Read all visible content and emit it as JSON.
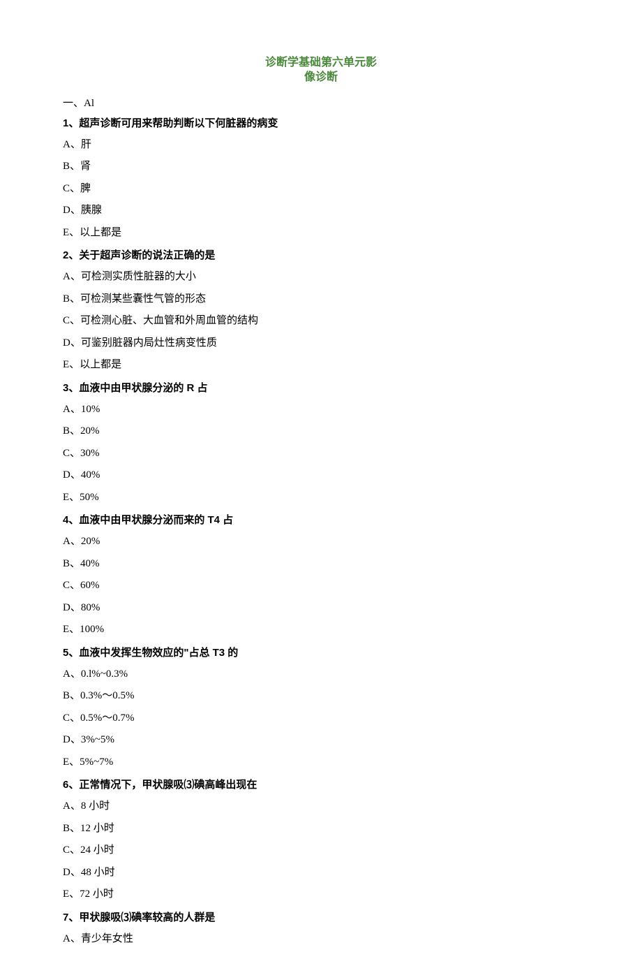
{
  "title_line1": "诊断学基础第六单元影",
  "title_line2": "像诊断",
  "section_label": "一、Al",
  "questions": [
    {
      "stem": "1、超声诊断可用来帮助判断以下何脏器的病变",
      "options": [
        "A、肝",
        "B、肾",
        "C、脾",
        "D、胰腺",
        "E、以上都是"
      ]
    },
    {
      "stem": "2、关于超声诊断的说法正确的是",
      "options": [
        "A、可检测实质性脏器的大小",
        "B、可检测某些囊性气管的形态",
        "C、可检测心脏、大血管和外周血管的结构",
        "D、可鉴别脏器内局灶性病变性质",
        "E、以上都是"
      ]
    },
    {
      "stem": "3、血液中由甲状腺分泌的 R 占",
      "options": [
        "A、10%",
        "B、20%",
        "C、30%",
        "D、40%",
        "E、50%"
      ]
    },
    {
      "stem": "4、血液中由甲状腺分泌而来的 T4 占",
      "options": [
        "A、20%",
        "B、40%",
        "C、60%",
        "D、80%",
        "E、100%"
      ]
    },
    {
      "stem": "5、血液中发挥生物效应的\"占总 T3 的",
      "options": [
        "A、0.l%~0.3%",
        "B、0.3%～0.5%",
        "C、0.5%～0.7%",
        "D、3%~5%",
        "E、5%~7%"
      ]
    },
    {
      "stem": "6、正常情况下，甲状腺吸⑶碘高峰出现在",
      "options": [
        "A、8 小时",
        "B、12 小时",
        "C、24 小时",
        "D、48 小时",
        "E、72 小时"
      ]
    },
    {
      "stem": "7、甲状腺吸⑶碘率较高的人群是",
      "options": [
        "A、青少年女性"
      ]
    }
  ]
}
